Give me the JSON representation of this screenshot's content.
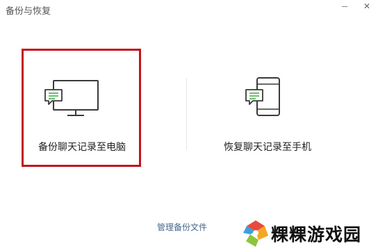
{
  "window": {
    "title": "备份与恢复",
    "minimize_icon": "minimize-icon",
    "close_icon": "close-icon",
    "close_glyph": "✕"
  },
  "options": [
    {
      "label": "备份聊天记录至电脑",
      "icon": "monitor-chat-icon",
      "selected": true
    },
    {
      "label": "恢复聊天记录至手机",
      "icon": "phone-chat-icon",
      "selected": false
    }
  ],
  "manage_link": "管理备份文件",
  "watermark": {
    "text": "粿粿游戏园",
    "logo": "watermark-logo"
  },
  "colors": {
    "highlight": "#c4121b",
    "chat_bubble_lines": "#45b24c",
    "icon_stroke": "#3a3a3a",
    "link": "#476a8a",
    "logo_colors": [
      "#e84a3c",
      "#f5a623",
      "#8cc63f",
      "#3aa0e0"
    ]
  }
}
